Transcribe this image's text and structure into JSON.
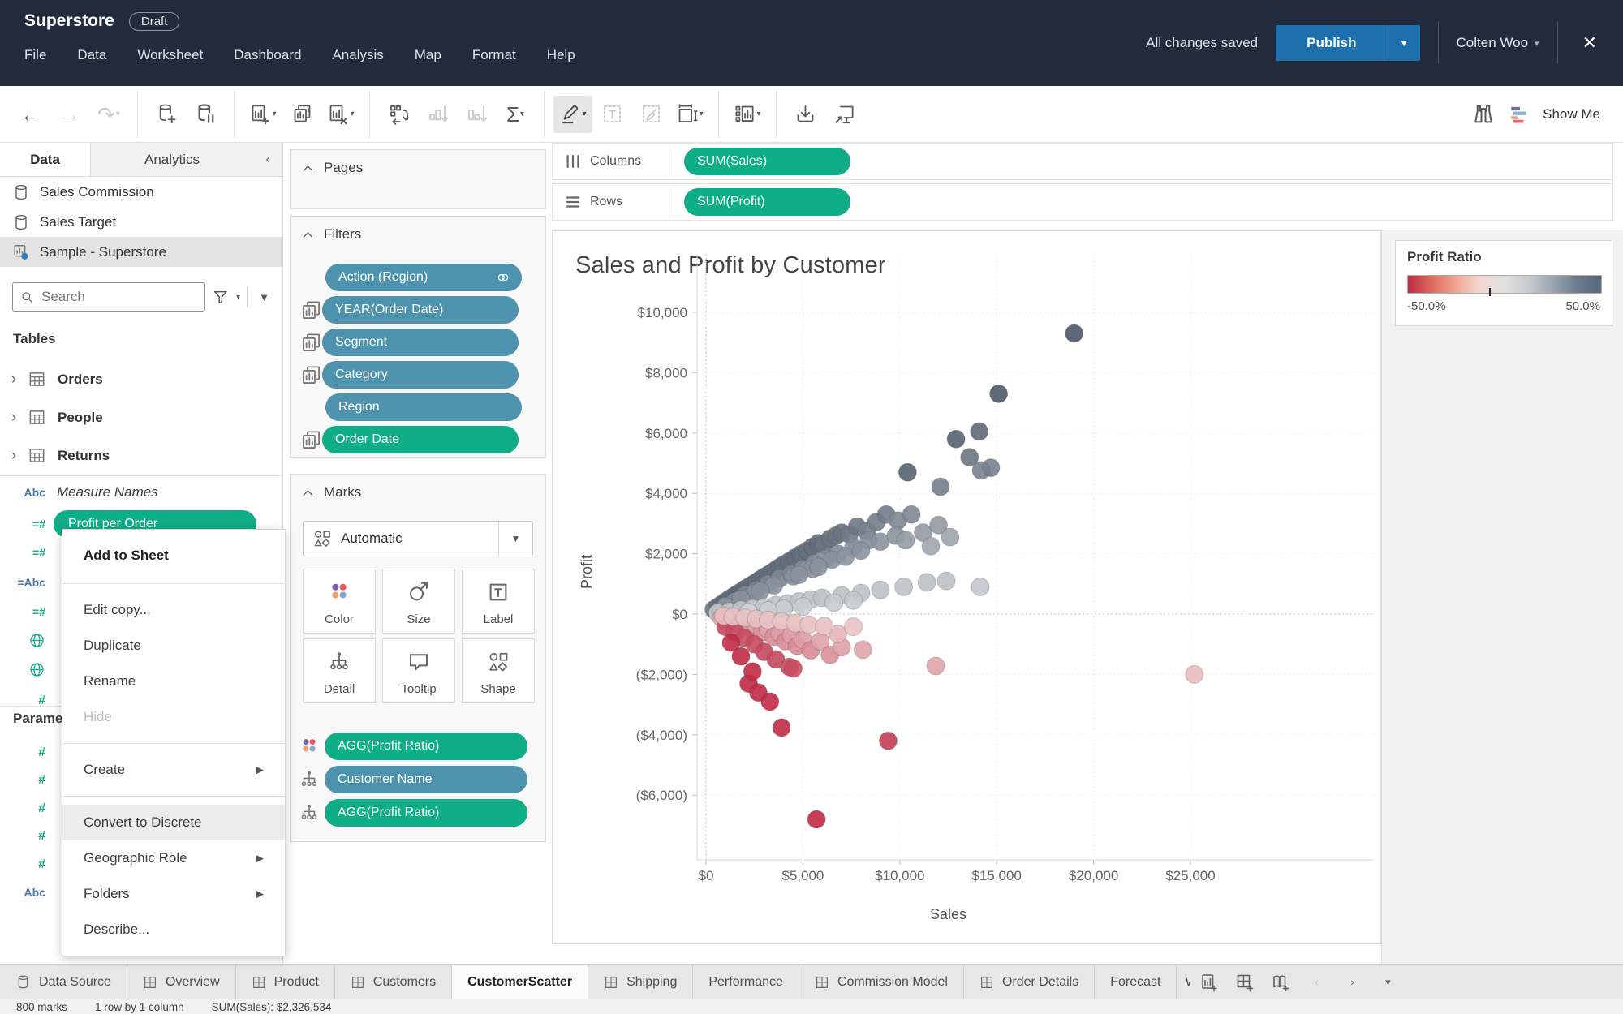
{
  "header": {
    "title": "Superstore",
    "badge": "Draft",
    "menus": [
      "File",
      "Data",
      "Worksheet",
      "Dashboard",
      "Analysis",
      "Map",
      "Format",
      "Help"
    ],
    "save_status": "All changes saved",
    "publish_label": "Publish",
    "user": "Colten Woo",
    "close_glyph": "✕",
    "header_bg": "#212b3c",
    "publish_blue": "#1d6fae"
  },
  "toolbar": {
    "groups": [
      [
        {
          "name": "undo",
          "icon": "glyph:←"
        },
        {
          "name": "redo",
          "icon": "glyph:→",
          "disabled": true
        },
        {
          "name": "replay",
          "icon": "glyph:↷",
          "disabled": true,
          "caret": true
        }
      ],
      [
        {
          "name": "new-data-source",
          "icon": "db-add"
        },
        {
          "name": "pause-auto-updates",
          "icon": "db-pause"
        }
      ],
      [
        {
          "name": "new-worksheet",
          "icon": "sheet-new",
          "caret": true
        },
        {
          "name": "duplicate-sheet",
          "icon": "sheet-dup"
        },
        {
          "name": "clear-sheet",
          "icon": "sheet-clear",
          "caret": true
        }
      ],
      [
        {
          "name": "swap-rows-columns",
          "icon": "swap"
        },
        {
          "name": "sort-ascending",
          "icon": "sort-asc",
          "disabled": true
        },
        {
          "name": "sort-descending",
          "icon": "sort-desc",
          "disabled": true
        },
        {
          "name": "totals",
          "icon": "glyph:Σ",
          "caret": true
        }
      ],
      [
        {
          "name": "highlight",
          "icon": "pencil",
          "active": true,
          "caret": true
        },
        {
          "name": "show-mark-labels",
          "icon": "text-label",
          "disabled": true
        },
        {
          "name": "annotate",
          "icon": "annotate",
          "disabled": true
        },
        {
          "name": "fit",
          "icon": "fit",
          "caret": true
        }
      ],
      [
        {
          "name": "fix-axes",
          "icon": "fix-axes",
          "caret": true
        }
      ],
      [
        {
          "name": "download",
          "icon": "download"
        },
        {
          "name": "presentation-mode",
          "icon": "present"
        }
      ]
    ],
    "show_me": "Show Me"
  },
  "data_pane": {
    "tabs": [
      "Data",
      "Analytics"
    ],
    "collapse_glyph": "‹",
    "sources": [
      {
        "label": "Sales Commission",
        "icon": "db"
      },
      {
        "label": "Sales Target",
        "icon": "db"
      },
      {
        "label": "Sample - Superstore",
        "icon": "ds-live",
        "selected": true
      }
    ],
    "search_placeholder": "Search",
    "tables_header": "Tables",
    "tables": [
      "Orders",
      "People",
      "Returns"
    ],
    "measure_names_label": "Measure Names",
    "selected_field": "Profit per Order",
    "field_icon_rows": [
      "calc-num",
      "calc-abc",
      "calc-num",
      "globe",
      "globe",
      "num"
    ],
    "parameters_header": "Parameters",
    "parameter_icon_rows": [
      "num",
      "num",
      "num",
      "num",
      "num",
      "abc"
    ]
  },
  "context_menu": {
    "items": [
      {
        "label": "Add to Sheet",
        "bold": true
      },
      {
        "divider": true
      },
      {
        "label": "Edit copy..."
      },
      {
        "label": "Duplicate"
      },
      {
        "label": "Rename"
      },
      {
        "label": "Hide",
        "disabled": true
      },
      {
        "divider": true
      },
      {
        "label": "Create",
        "submenu": true
      },
      {
        "divider": true
      },
      {
        "label": "Convert to Discrete",
        "highlighted": true
      },
      {
        "label": "Geographic Role",
        "submenu": true
      },
      {
        "label": "Folders",
        "submenu": true
      },
      {
        "label": "Describe..."
      }
    ]
  },
  "shelves": {
    "pages_label": "Pages",
    "filters_label": "Filters",
    "filter_pills": [
      {
        "label": "Action (Region)",
        "color": "blue",
        "right_icon": "rings"
      },
      {
        "label": "YEAR(Order Date)",
        "color": "blue",
        "left_icon": "multi-sheet"
      },
      {
        "label": "Segment",
        "color": "blue",
        "left_icon": "multi-sheet"
      },
      {
        "label": "Category",
        "color": "blue",
        "left_icon": "multi-sheet"
      },
      {
        "label": "Region",
        "color": "blue"
      },
      {
        "label": "Order Date",
        "color": "green",
        "left_icon": "multi-sheet"
      }
    ],
    "marks_label": "Marks",
    "marks_type": "Automatic",
    "marks_buttons": [
      {
        "label": "Color",
        "icon": "color-dots"
      },
      {
        "label": "Size",
        "icon": "size"
      },
      {
        "label": "Label",
        "icon": "label"
      },
      {
        "label": "Detail",
        "icon": "detail"
      },
      {
        "label": "Tooltip",
        "icon": "tooltip"
      },
      {
        "label": "Shape",
        "icon": "shape"
      }
    ],
    "marks_pills": [
      {
        "label": "AGG(Profit Ratio)",
        "color": "green",
        "icon": "color-dots"
      },
      {
        "label": "Customer Name",
        "color": "blue",
        "icon": "detail"
      },
      {
        "label": "AGG(Profit Ratio)",
        "color": "green",
        "icon": "detail"
      }
    ],
    "columns_label": "Columns",
    "columns_pills": [
      "SUM(Sales)"
    ],
    "rows_label": "Rows",
    "rows_pills": [
      "SUM(Profit)"
    ],
    "pill_green": "#0fae87",
    "pill_blue": "#4e93ad"
  },
  "chart_data": {
    "type": "scatter",
    "title": "Sales and Profit by Customer",
    "xlabel": "Sales",
    "ylabel": "Profit",
    "x_ticks": [
      "$0",
      "$5,000",
      "$10,000",
      "$15,000",
      "$20,000",
      "$25,000"
    ],
    "x_tick_values": [
      0,
      5000,
      10000,
      15000,
      20000,
      25000
    ],
    "y_ticks": [
      "$10,000",
      "$8,000",
      "$6,000",
      "$4,000",
      "$2,000",
      "$0",
      "($2,000)",
      "($4,000)",
      "($6,000)"
    ],
    "y_tick_values": [
      10000,
      8000,
      6000,
      4000,
      2000,
      0,
      -2000,
      -4000,
      -6000
    ],
    "xlim": [
      -500,
      26500
    ],
    "ylim": [
      -7800,
      11000
    ],
    "gridlines": "dotted",
    "zero_lines": true,
    "color_encoding": {
      "field": "AGG(Profit Ratio)",
      "domain": [
        -0.5,
        0.5
      ],
      "negative_color": "#bf2b45",
      "center_color": "#ece8e6",
      "positive_color": "#495665"
    },
    "points": [
      [
        400,
        150
      ],
      [
        600,
        230
      ],
      [
        800,
        320
      ],
      [
        1000,
        410
      ],
      [
        1200,
        500
      ],
      [
        1400,
        580
      ],
      [
        1600,
        660
      ],
      [
        1800,
        740
      ],
      [
        2000,
        830
      ],
      [
        2200,
        900
      ],
      [
        2400,
        980
      ],
      [
        2600,
        1060
      ],
      [
        2800,
        1150
      ],
      [
        3000,
        1230
      ],
      [
        3200,
        1300
      ],
      [
        3400,
        1380
      ],
      [
        3600,
        1470
      ],
      [
        3800,
        1550
      ],
      [
        4000,
        1640
      ],
      [
        4300,
        1750
      ],
      [
        4600,
        1870
      ],
      [
        4900,
        1990
      ],
      [
        5200,
        2100
      ],
      [
        5500,
        2230
      ],
      [
        5800,
        2350
      ],
      [
        6100,
        2300
      ],
      [
        6400,
        2500
      ],
      [
        6700,
        2600
      ],
      [
        7000,
        2700
      ],
      [
        7400,
        2640
      ],
      [
        7800,
        2900
      ],
      [
        8300,
        2750
      ],
      [
        8800,
        3050
      ],
      [
        9300,
        3300
      ],
      [
        9900,
        3100
      ],
      [
        10600,
        3300
      ],
      [
        11200,
        2700
      ],
      [
        12000,
        2950
      ],
      [
        11600,
        2250
      ],
      [
        12600,
        2550
      ],
      [
        2000,
        640
      ],
      [
        2600,
        800
      ],
      [
        3200,
        1000
      ],
      [
        3800,
        1180
      ],
      [
        4400,
        1320
      ],
      [
        5000,
        1500
      ],
      [
        5600,
        1680
      ],
      [
        6200,
        1850
      ],
      [
        6800,
        2000
      ],
      [
        7600,
        2200
      ],
      [
        8400,
        2450
      ],
      [
        1500,
        420
      ],
      [
        2500,
        700
      ],
      [
        3500,
        950
      ],
      [
        4500,
        1250
      ],
      [
        5500,
        1500
      ],
      [
        6500,
        1800
      ],
      [
        1000,
        260
      ],
      [
        1800,
        500
      ],
      [
        2800,
        760
      ],
      [
        4800,
        1300
      ],
      [
        5800,
        1560
      ],
      [
        7200,
        1900
      ],
      [
        8000,
        2100
      ],
      [
        9000,
        2400
      ],
      [
        9800,
        2600
      ],
      [
        10300,
        2450
      ],
      [
        600,
        40
      ],
      [
        1200,
        90
      ],
      [
        1800,
        140
      ],
      [
        2400,
        190
      ],
      [
        3000,
        240
      ],
      [
        3600,
        300
      ],
      [
        4200,
        350
      ],
      [
        4800,
        420
      ],
      [
        5400,
        480
      ],
      [
        6000,
        540
      ],
      [
        7000,
        620
      ],
      [
        8000,
        700
      ],
      [
        9000,
        800
      ],
      [
        10200,
        900
      ],
      [
        11400,
        1050
      ],
      [
        14150,
        900
      ],
      [
        12400,
        1100
      ],
      [
        6600,
        380
      ],
      [
        7600,
        450
      ],
      [
        5000,
        250
      ],
      [
        4000,
        180
      ],
      [
        3200,
        120
      ],
      [
        2200,
        60
      ],
      [
        19000,
        9300
      ],
      [
        15100,
        7300
      ],
      [
        12900,
        5800
      ],
      [
        14100,
        6050
      ],
      [
        14700,
        4850
      ],
      [
        13600,
        5200
      ],
      [
        14200,
        4760
      ],
      [
        10400,
        4700
      ],
      [
        12100,
        4220
      ],
      [
        800,
        -120
      ],
      [
        1100,
        -220
      ],
      [
        1400,
        -180
      ],
      [
        1700,
        -350
      ],
      [
        2000,
        -280
      ],
      [
        2300,
        -480
      ],
      [
        2600,
        -380
      ],
      [
        2900,
        -600
      ],
      [
        3200,
        -500
      ],
      [
        3500,
        -750
      ],
      [
        3800,
        -620
      ],
      [
        4100,
        -900
      ],
      [
        4400,
        -700
      ],
      [
        4700,
        -1050
      ],
      [
        5000,
        -850
      ],
      [
        5400,
        -1200
      ],
      [
        5900,
        -900
      ],
      [
        6400,
        -1350
      ],
      [
        7000,
        -1100
      ],
      [
        1000,
        -420
      ],
      [
        1500,
        -600
      ],
      [
        2000,
        -800
      ],
      [
        2500,
        -1000
      ],
      [
        3000,
        -1250
      ],
      [
        3600,
        -1500
      ],
      [
        4300,
        -1750
      ],
      [
        2200,
        -2300
      ],
      [
        2700,
        -2600
      ],
      [
        3300,
        -2900
      ],
      [
        3900,
        -3760
      ],
      [
        2400,
        -1900
      ],
      [
        9400,
        -4200
      ],
      [
        11850,
        -1720
      ],
      [
        25200,
        -2000
      ],
      [
        5700,
        -6800
      ],
      [
        8100,
        -1180
      ],
      [
        4500,
        -1800
      ],
      [
        6800,
        -650
      ],
      [
        7600,
        -420
      ],
      [
        1300,
        -950
      ],
      [
        1800,
        -1400
      ],
      [
        900,
        -60
      ],
      [
        1400,
        -90
      ],
      [
        2000,
        -120
      ],
      [
        2600,
        -160
      ],
      [
        3200,
        -200
      ],
      [
        3900,
        -240
      ],
      [
        4600,
        -300
      ],
      [
        5300,
        -350
      ],
      [
        6100,
        -400
      ]
    ]
  },
  "legend": {
    "title": "Profit Ratio",
    "min_label": "-50.0%",
    "max_label": "50.0%",
    "gradient": [
      "#bf2b45",
      "#e06a5f",
      "#f0a795",
      "#f2d8d2",
      "#e0e0df",
      "#c6cbd0",
      "#9aa5b1",
      "#6b7b8d",
      "#55677a"
    ],
    "tick_position": 0.42
  },
  "tabs_bar": {
    "tabs": [
      {
        "label": "Data Source",
        "icon": "db"
      },
      {
        "label": "Overview",
        "icon": "dashboard"
      },
      {
        "label": "Product",
        "icon": "dashboard"
      },
      {
        "label": "Customers",
        "icon": "dashboard"
      },
      {
        "label": "CustomerScatter",
        "active": true
      },
      {
        "label": "Shipping",
        "icon": "dashboard"
      },
      {
        "label": "Performance"
      },
      {
        "label": "Commission Model",
        "icon": "dashboard"
      },
      {
        "label": "Order Details",
        "icon": "dashboard"
      },
      {
        "label": "Forecast"
      },
      {
        "label": "W",
        "partial": true
      }
    ],
    "controls": [
      {
        "name": "new-worksheet",
        "icon": "sheet-new"
      },
      {
        "name": "new-dashboard",
        "icon": "dash-new"
      },
      {
        "name": "new-story",
        "icon": "story-new"
      },
      {
        "name": "prev-tab",
        "icon": "glyph-small:‹",
        "disabled": true
      },
      {
        "name": "next-tab",
        "icon": "glyph-small:›"
      },
      {
        "name": "tab-list",
        "icon": "glyph-small:▾"
      }
    ]
  },
  "status_bar": {
    "marks": "800 marks",
    "layout": "1 row by 1 column",
    "aggregate": "SUM(Sales): $2,326,534"
  }
}
